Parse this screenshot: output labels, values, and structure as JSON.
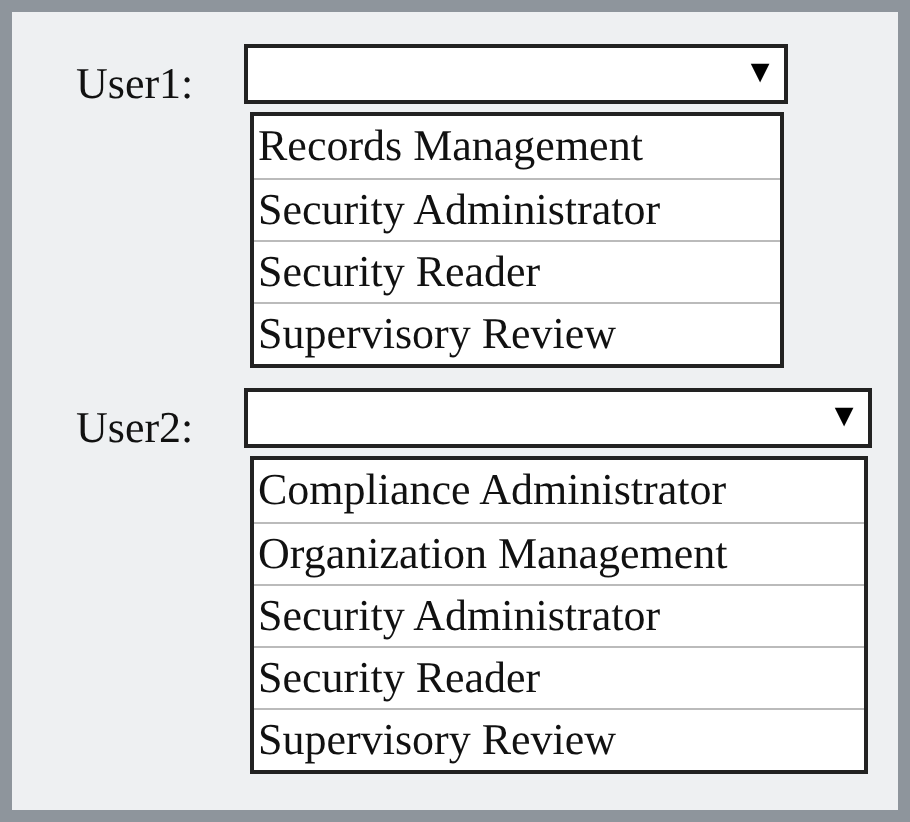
{
  "users": [
    {
      "label": "User1:",
      "arrow": "▼",
      "options": [
        "Records Management",
        "Security Administrator",
        "Security Reader",
        "Supervisory Review"
      ]
    },
    {
      "label": "User2:",
      "arrow": "▼",
      "options": [
        "Compliance Administrator",
        "Organization Management",
        "Security Administrator",
        "Security Reader",
        "Supervisory Review"
      ]
    }
  ]
}
